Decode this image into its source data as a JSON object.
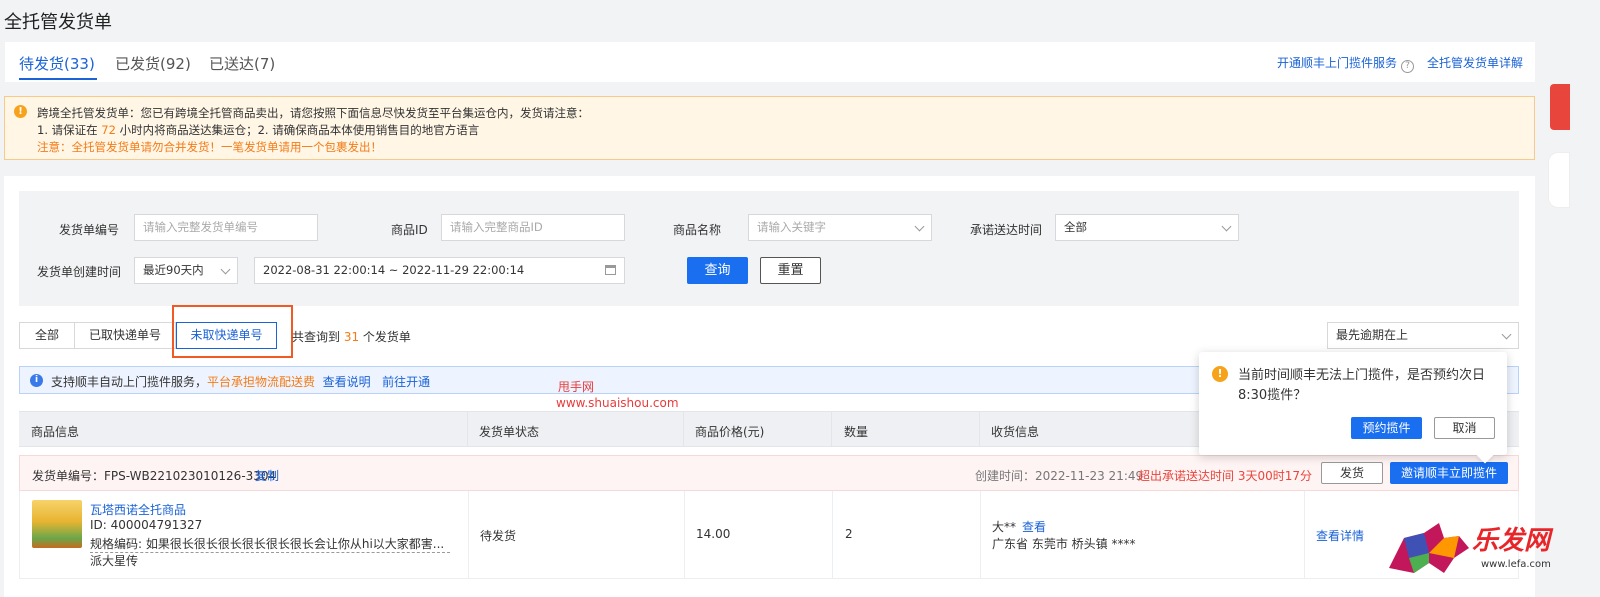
{
  "page_title": "全托管发货单",
  "tabs": [
    {
      "label": "待发货(33)"
    },
    {
      "label": "已发货(92)"
    },
    {
      "label": "已送达(7)"
    }
  ],
  "top_links": {
    "sf_service": "开通顺丰上门揽件服务",
    "detail": "全托管发货单详解"
  },
  "notice": {
    "line1": "跨境全托管发货单：您已有跨境全托管商品卖出，请您按照下面信息尽快发货至平台集运仓内，发货请注意：",
    "line2_a": "1. 请保证在 ",
    "line2_hours": "72",
    "line2_b": " 小时内将商品送达集运仓；2. 请确保商品本体使用销售目的地官方语言",
    "line3": "注意：全托管发货单请勿合并发货！一笔发货单请用一个包裹发出！"
  },
  "filters": {
    "order_no_label": "发货单编号",
    "order_no_placeholder": "请输入完整发货单编号",
    "product_id_label": "商品ID",
    "product_id_placeholder": "请输入完整商品ID",
    "product_name_label": "商品名称",
    "product_name_placeholder": "请输入关键字",
    "promise_time_label": "承诺送达时间",
    "promise_time_value": "全部",
    "create_time_label": "发货单创建时间",
    "create_range_value": "最近90天内",
    "date_range_value": "2022-08-31 22:00:14 ~ 2022-11-29 22:00:14",
    "search_button": "查询",
    "reset_button": "重置"
  },
  "segments": [
    {
      "label": "全部"
    },
    {
      "label": "已取快递单号"
    },
    {
      "label": "未取快递单号"
    }
  ],
  "result_count": {
    "prefix": "共查询到 ",
    "count": "31",
    "suffix": " 个发货单"
  },
  "sort_value": "最先逾期在上",
  "info_bar": {
    "text": "支持顺丰自动上门揽件服务，",
    "highlight": "平台承担物流配送费",
    "link1": "查看说明",
    "link2": "前往开通"
  },
  "watermark": {
    "line1": "甩手网",
    "line2": "www.shuaishou.com"
  },
  "table_headers": [
    "商品信息",
    "发货单状态",
    "商品价格(元)",
    "数量",
    "收货信息"
  ],
  "order": {
    "no_label": "发货单编号：FPS-WB221023010126-3304",
    "copy_label": "复制",
    "created_time": "创建时间：2022-11-23 21:49",
    "overdue": "超出承诺送达时间 3天00时17分",
    "ship_button": "发货",
    "invite_button": "邀请顺丰立即揽件",
    "product_name": "瓦塔西诺全托商品",
    "product_id": "ID: 400004791327",
    "spec": "规格编码: 如果很长很长很长很长很长很长会让你从hi以大家都害...",
    "spec2": "派大星传",
    "status": "待发货",
    "price": "14.00",
    "qty": "2",
    "receiver_name": "大**",
    "receiver_view": "查看",
    "receiver_addr": "广东省 东莞市 桥头镇 ****",
    "detail_link": "查看详情"
  },
  "popover": {
    "message": "当前时间顺丰无法上门揽件，是否预约次日8:30揽件？",
    "confirm": "预约揽件",
    "cancel": "取消"
  },
  "brand": {
    "name": "乐发网",
    "url": "www.lefa.com"
  },
  "colors": {
    "primary": "#1a6ef0",
    "link": "#1a62d6",
    "warning": "#f47b17",
    "danger": "#e8453c"
  }
}
